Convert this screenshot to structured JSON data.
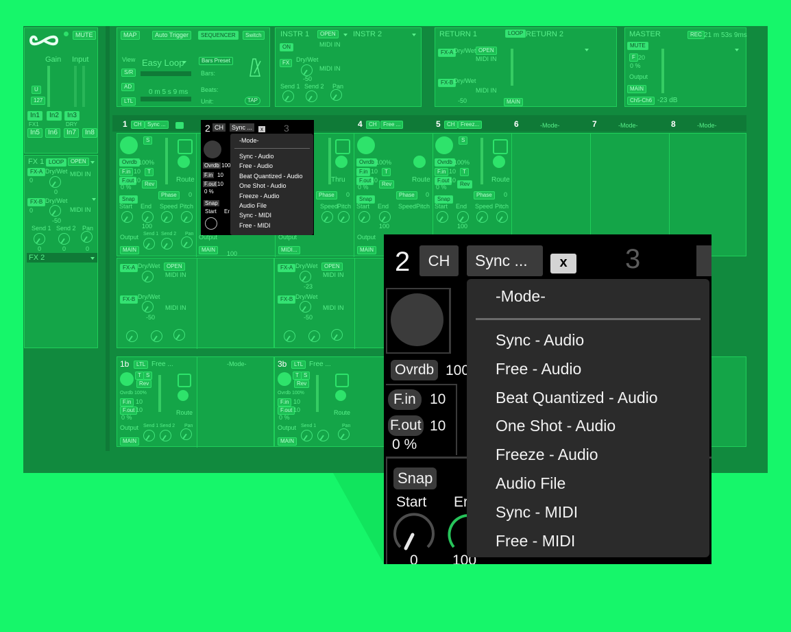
{
  "left_strip": {
    "mute": "MUTE",
    "gain": "Gain",
    "input": "Input",
    "u": "U",
    "val127": "127",
    "in_buttons": [
      "In1",
      "In2",
      "In3"
    ],
    "fx1_lbl": "FX1",
    "dry_lbl": "DRY",
    "in_buttons2": [
      "In5",
      "In6",
      "In7",
      "In8"
    ]
  },
  "left_fx1": {
    "title": "FX 1",
    "loop": "LOOP",
    "open": "OPEN",
    "fxa": "FX-A",
    "drywet": "Dry/Wet",
    "midi_in": "MIDI IN",
    "zero": "0",
    "fxb": "FX-B",
    "drywet2": "Dry/Wet",
    "midi_in2": "MIDI IN",
    "neg50": "-50",
    "send1": "Send 1",
    "send2": "Send 2",
    "pan": "Pan",
    "fx2": "FX 2"
  },
  "top": {
    "map": "MAP",
    "auto_trigger": "Auto Trigger",
    "sequencer": "SEQUENCER",
    "switch": "Switch",
    "view": "View",
    "sr": "S/R",
    "ad": "AD",
    "ltl": "LTL",
    "easy_loop": "Easy Loop",
    "time": "0 m  5  s 9 ms",
    "bars_preset": "Bars Preset",
    "bars": "Bars:",
    "beats": "Beats:",
    "unit": "Unit:",
    "tap": "TAP",
    "instr1": "INSTR 1",
    "open": "OPEN",
    "on": "ON",
    "midi_in": "MIDI IN",
    "fx": "FX",
    "drywet": "Dry/Wet",
    "send1": "Send 1",
    "send2": "Send 2",
    "pan": "Pan",
    "neg50": "-50",
    "instr2": "INSTR 2",
    "return1": "RETURN 1",
    "loop": "LOOP",
    "return2": "RETURN 2",
    "fxa": "FX-A",
    "fxb": "FX-B",
    "main": "MAIN",
    "master": "MASTER",
    "rec": "REC",
    "rec_time": "21 m 53s 9ms",
    "mute": "MUTE",
    "f": "F",
    "f20": "20",
    "pct0": "0  %",
    "output": "Output",
    "ch5ch6": "Ch5-Ch6",
    "db": "-23 dB"
  },
  "channels": [
    {
      "num": "1",
      "ch": "CH",
      "mode": "Sync ..."
    },
    {
      "num": "4",
      "ch": "CH",
      "mode": "Free ..."
    },
    {
      "num": "5",
      "ch": "CH",
      "mode": "Freez..."
    },
    {
      "num": "6",
      "mode": "-Mode-"
    },
    {
      "num": "7",
      "mode": "-Mode-"
    },
    {
      "num": "8",
      "mode": "-Mode-"
    }
  ],
  "strip": {
    "s": "S",
    "ovrdb": "Ovrdb",
    "pct100": "100%",
    "fin": "F.in",
    "ten": "10",
    "t": "T",
    "fout": "F.out",
    "rev": "Rev",
    "pct0": "0  %",
    "route": "Route",
    "thru": "Thru",
    "phase": "Phase",
    "zero": "0",
    "snap": "Snap",
    "start": "Start",
    "end": "End",
    "speed": "Speed",
    "pitch": "Pitch",
    "hundred": "100",
    "output": "Output",
    "send1": "Send 1",
    "send2": "Send 2",
    "pan": "Pan",
    "main": "MAIN",
    "midi_ell": "MIDI..."
  },
  "fx_rows": {
    "fxa": "FX-A",
    "drywet": "Dry/Wet",
    "open": "OPEN",
    "midi_in": "MIDI IN",
    "fxb": "FX-B",
    "neg50": "-50",
    "neg23": "-23"
  },
  "bottom": {
    "b1": "1b",
    "b3": "3b",
    "ltl": "LTL",
    "free": "Free ...",
    "mode": "-Mode-",
    "t": "T",
    "s": "S",
    "rev": "Rev",
    "ovrdb100": "Ovrdb 100%",
    "fin": "F.in",
    "fout": "F.out",
    "ten": "10",
    "pct0": "0   %",
    "route": "Route",
    "output": "Output",
    "main": "MAIN",
    "send1": "Send 1",
    "send2": "Send 2",
    "pan": "Pan",
    "zero": "0"
  },
  "small_popup": {
    "num": "2",
    "ch": "CH",
    "mode": "Sync ...",
    "x": "x",
    "next_num": "3",
    "ovrdb": "Ovrdb",
    "ovrdb_val": "100",
    "fin": "F.in",
    "fin_val": "10",
    "fout": "F.out",
    "fout_val": "10",
    "pct": "0  %",
    "snap": "Snap",
    "start": "Start",
    "end_abbr": "Er",
    "hundred": "100",
    "items": [
      "-Mode-",
      "Sync - Audio",
      "Free - Audio",
      "Beat Quantized - Audio",
      "One Shot - Audio",
      "Freeze - Audio",
      "Audio File",
      "Sync - MIDI",
      "Free - MIDI"
    ]
  },
  "zoom": {
    "num": "2",
    "ch": "CH",
    "mode": "Sync ...",
    "x": "x",
    "next_num": "3",
    "ovrdb": "Ovrdb",
    "ovrdb_val": "100",
    "fin": "F.in",
    "fin_val": "10",
    "fout": "F.out",
    "fout_val": "10",
    "pct": "0  %",
    "snap": "Snap",
    "start": "Start",
    "end_abbr": "Er",
    "zero": "0",
    "hundred": "100",
    "items": [
      "-Mode-",
      "Sync - Audio",
      "Free - Audio",
      "Beat Quantized - Audio",
      "One Shot - Audio",
      "Freeze - Audio",
      "Audio File",
      "Sync - MIDI",
      "Free - MIDI"
    ]
  }
}
